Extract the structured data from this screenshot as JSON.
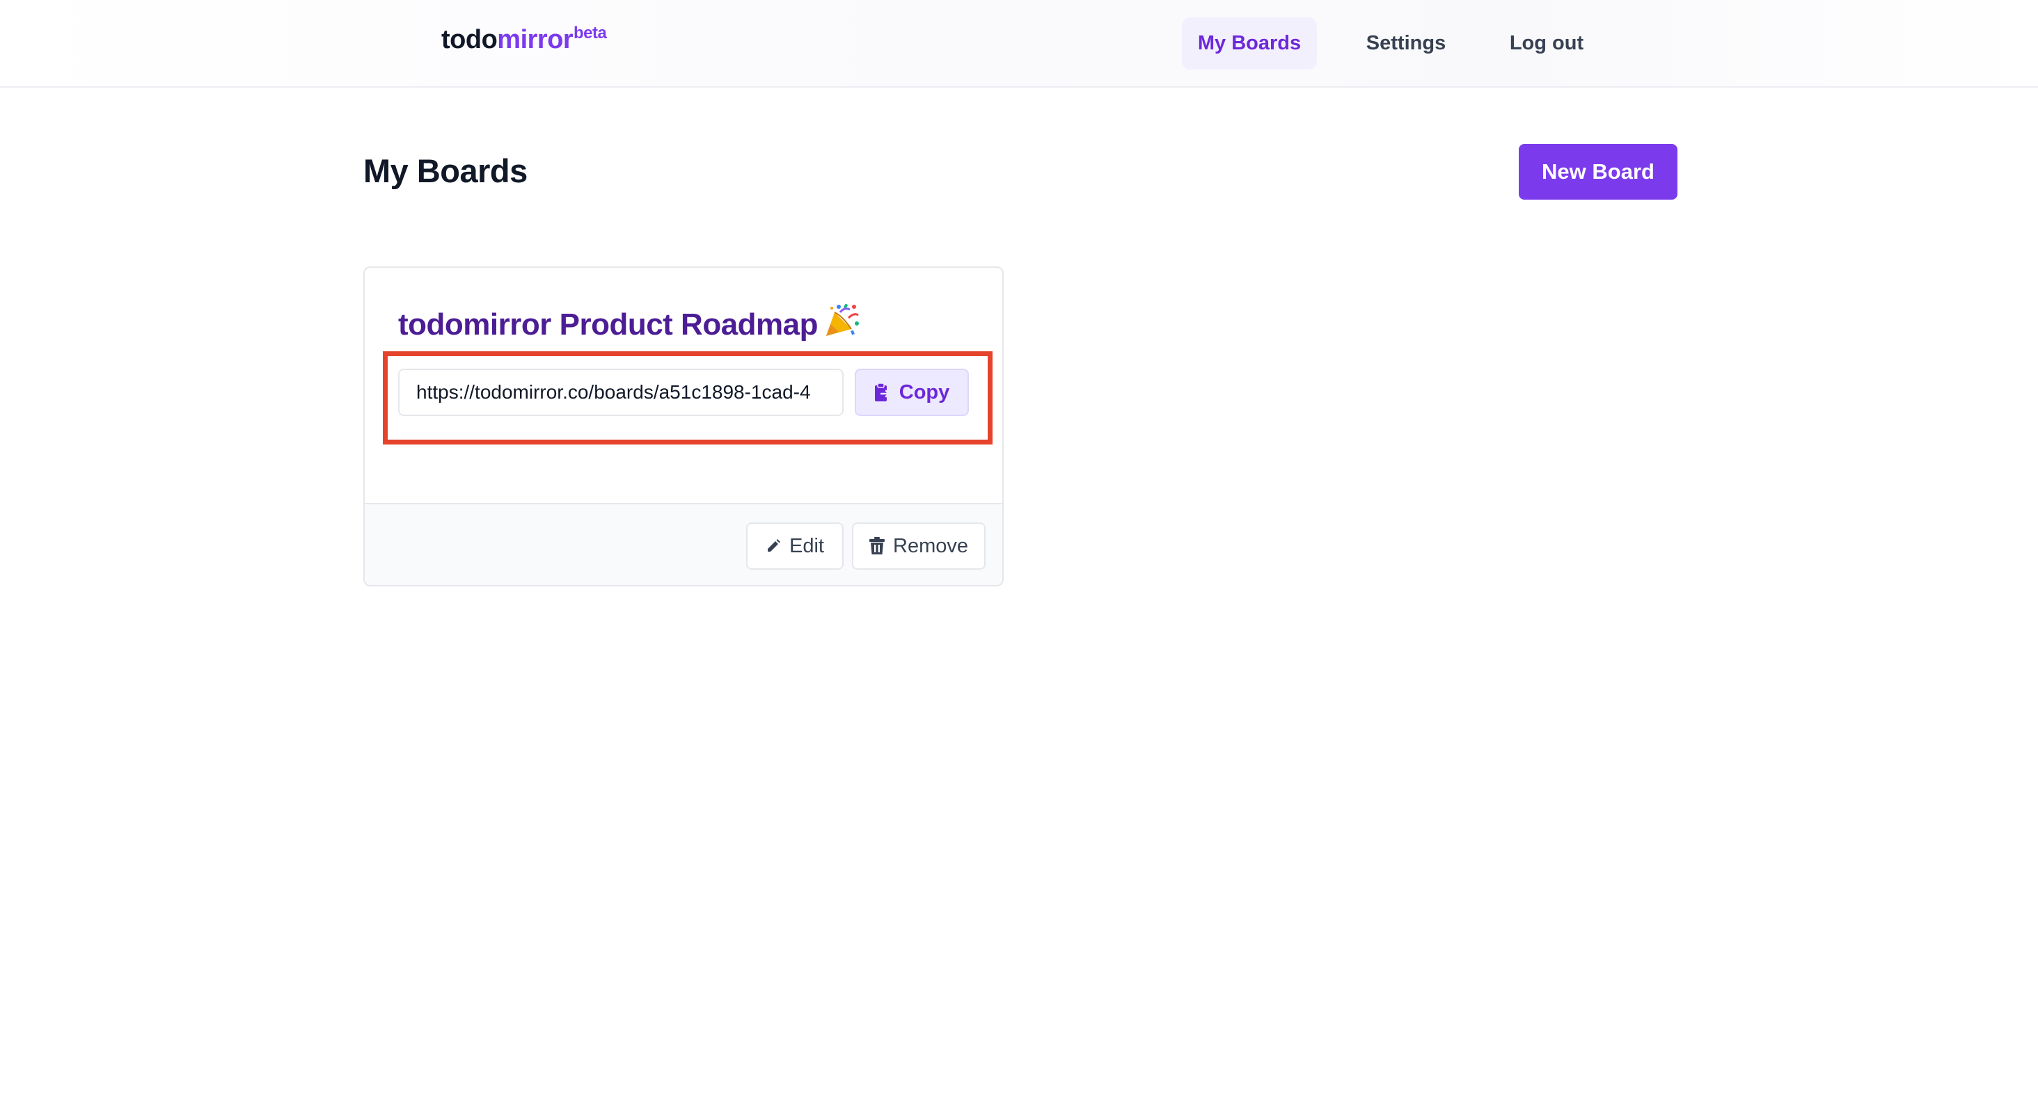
{
  "header": {
    "logo": {
      "part1": "todo",
      "part2": "mirror",
      "badge": "beta"
    },
    "nav": [
      {
        "label": "My Boards",
        "active": true
      },
      {
        "label": "Settings",
        "active": false
      },
      {
        "label": "Log out",
        "active": false
      }
    ]
  },
  "main": {
    "title": "My Boards",
    "new_board_label": "New Board",
    "boards": [
      {
        "title": "todomirror Product Roadmap",
        "emoji_icon": "party-popper-icon",
        "share_url": "https://todomirror.co/boards/a51c1898-1cad-4",
        "copy_label": "Copy",
        "edit_label": "Edit",
        "remove_label": "Remove"
      }
    ]
  },
  "colors": {
    "accent": "#7c3aed",
    "accent_dark": "#4c1d95",
    "highlight": "#e5432c",
    "nav_active_bg": "#f3f0fd"
  }
}
